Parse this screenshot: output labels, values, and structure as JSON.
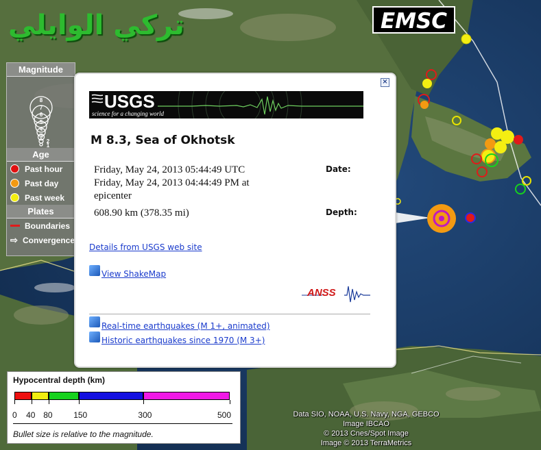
{
  "watermark": "تركي الوايلي",
  "logo": "EMSC",
  "legend": {
    "magnitude_title": "Magnitude",
    "magnitudes": [
      "8",
      "7",
      "6",
      "5",
      "4",
      "3",
      "2",
      "1"
    ],
    "age_title": "Age",
    "age_items": [
      {
        "label": "Past hour",
        "color": "#e01010"
      },
      {
        "label": "Past day",
        "color": "#f39a12"
      },
      {
        "label": "Past week",
        "color": "#f2ee10"
      }
    ],
    "plates_title": "Plates",
    "plate_items": [
      {
        "label": "Boundaries",
        "icon": "red-line-icon"
      },
      {
        "label": "Convergence",
        "icon": "arrow-right-icon"
      }
    ]
  },
  "popup": {
    "banner_logo": "USGS",
    "banner_tagline": "science for a changing world",
    "title": "M 8.3, Sea of Okhotsk",
    "date_label": "Date:",
    "date_utc": "Friday, May 24, 2013 05:44:49 UTC",
    "date_local": "Friday, May 24, 2013 04:44:49 PM at",
    "date_local_suffix": "epicenter",
    "depth_label": "Depth:",
    "depth_value": "608.90 km (378.35 mi)",
    "links": {
      "details": "Details from USGS web site",
      "shakemap": "View ShakeMap",
      "realtime": "Real-time earthquakes (M 1+, animated)",
      "historic": "Historic earthquakes since 1970 (M 3+)"
    },
    "anss": "ANSS"
  },
  "depth_scale": {
    "title": "Hypocentral depth (km)",
    "ticks": [
      "0",
      "40",
      "80",
      "150",
      "300",
      "500"
    ],
    "segments": [
      {
        "from": 0,
        "to": 40,
        "color": "#ee1111"
      },
      {
        "from": 40,
        "to": 80,
        "color": "#f2ee10"
      },
      {
        "from": 80,
        "to": 150,
        "color": "#17d21e"
      },
      {
        "from": 150,
        "to": 300,
        "color": "#1410e0"
      },
      {
        "from": 300,
        "to": 500,
        "color": "#f019e6"
      }
    ],
    "note": "Bullet size is relative to the magnitude."
  },
  "credits": [
    "Data SIO, NOAA, U.S. Navy, NGA, GEBCO",
    "Image IBCAO",
    "© 2013 Cnes/Spot Image",
    "Image © 2013 TerraMetrics"
  ],
  "colors": {
    "land": "#4e6b3a",
    "sea": "#1b3a63",
    "boundary": "#ffffff"
  }
}
